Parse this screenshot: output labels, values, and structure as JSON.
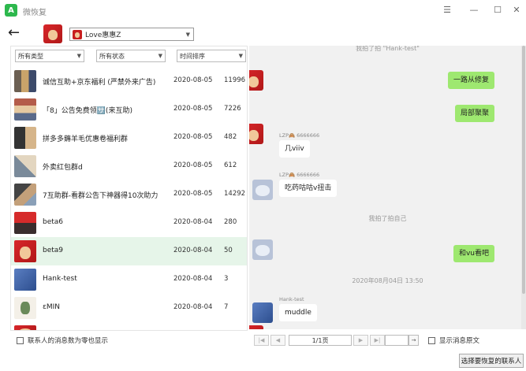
{
  "app": {
    "title": "微恢复",
    "logo_glyph": "A"
  },
  "window": {
    "menu_glyph": "☰",
    "minimize_glyph": "—",
    "maximize_glyph": "☐",
    "close_glyph": "✕"
  },
  "header": {
    "back_glyph": "←",
    "account": "Love惠惠Z",
    "account_caret": "▼"
  },
  "filters": [
    {
      "label": "所有类型"
    },
    {
      "label": "所有状态"
    },
    {
      "label": "时间排序"
    }
  ],
  "filter_caret": "▼",
  "conversations": [
    {
      "name": "诚信互助+京东福利 (严禁外来广告)",
      "date": "2020-08-05",
      "count": "11996",
      "avatar": "pat-grid"
    },
    {
      "name": "「8」公告免费领🈂️(来互助)",
      "date": "2020-08-05",
      "count": "7226",
      "avatar": "pat-grid2"
    },
    {
      "name": "拼多多薅羊毛优惠卷福利群",
      "date": "2020-08-05",
      "count": "482",
      "avatar": "pat-grid3"
    },
    {
      "name": "外卖红包群d",
      "date": "2020-08-05",
      "count": "612",
      "avatar": "pat-grid4"
    },
    {
      "name": "7互助群-看群公告下神器得10次助力",
      "date": "2020-08-05",
      "count": "14292",
      "avatar": "pat-grid5"
    },
    {
      "name": "beta6",
      "date": "2020-08-04",
      "count": "280",
      "avatar": "pat-beta6"
    },
    {
      "name": "beta9",
      "date": "2020-08-04",
      "count": "50",
      "avatar": "pat-red",
      "selected": true
    },
    {
      "name": "Hank-test",
      "date": "2020-08-04",
      "count": "3",
      "avatar": "pat-hank"
    },
    {
      "name": "εMIN",
      "date": "2020-08-04",
      "count": "7",
      "avatar": "pat-emin"
    }
  ],
  "left_footer": {
    "label": "联系人的消息数为零也显示"
  },
  "chat": {
    "top_system": "我拍了拍 \"Hank-test\"",
    "messages": [
      {
        "side": "me",
        "text": "一路从修复"
      },
      {
        "side": "me",
        "text": "局部聚聚"
      },
      {
        "side": "them",
        "sender": "LZP🙈 6666666",
        "text": "几viiv"
      },
      {
        "side": "them",
        "sender": "LZP🙈 6666666",
        "text": "吃药咕咕v扭击"
      },
      {
        "side": "system",
        "text": "我拍了拍自己"
      },
      {
        "side": "me",
        "text": "和vu看吧"
      },
      {
        "side": "system",
        "text": "2020年08月04日 13:50"
      },
      {
        "side": "them",
        "sender": "Hank-test",
        "text": "muddle"
      }
    ]
  },
  "pager": {
    "first": "|◀",
    "prev": "◀",
    "page": "1/1页",
    "next": "▶",
    "last": "▶|",
    "jump": "→"
  },
  "show_original": {
    "label": "显示消息原文"
  },
  "bottom_button": {
    "label": "选择要恢复的联系人"
  }
}
